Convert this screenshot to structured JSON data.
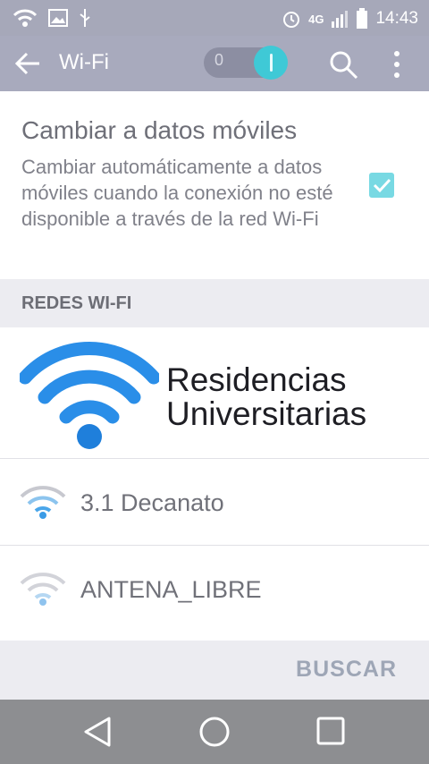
{
  "status_bar": {
    "time": "14:43",
    "network_type": "4G",
    "icons": [
      "wifi-icon",
      "image-icon",
      "usb-icon",
      "alarm-icon",
      "signal-icon",
      "battery-icon"
    ]
  },
  "toolbar": {
    "title": "Wi-Fi",
    "toggle_off_label": "0",
    "toggle_state": "on",
    "icons": [
      "back-arrow-icon",
      "search-icon",
      "more-options-icon"
    ]
  },
  "mobile_data_setting": {
    "title": "Cambiar a datos móviles",
    "description": "Cambiar automáticamente a datos móviles cuando la conexión no esté disponible a través de la red Wi-Fi",
    "checked": true
  },
  "wifi_networks": {
    "header": "REDES WI-FI",
    "banner_line1": "Residencias",
    "banner_line2": "Universitarias",
    "networks": [
      {
        "name": "3.1 Decanato",
        "signal": "medium"
      },
      {
        "name": "ANTENA_LIBRE",
        "signal": "weak"
      }
    ]
  },
  "actions": {
    "scan_label": "BUSCAR"
  },
  "nav_bar": {
    "icons": [
      "back-triangle-icon",
      "home-circle-icon",
      "recents-square-icon"
    ]
  },
  "colors": {
    "accent": "#3fc9d6",
    "wifi_blue": "#2a8ee8",
    "toolbar": "#a8aabd"
  }
}
